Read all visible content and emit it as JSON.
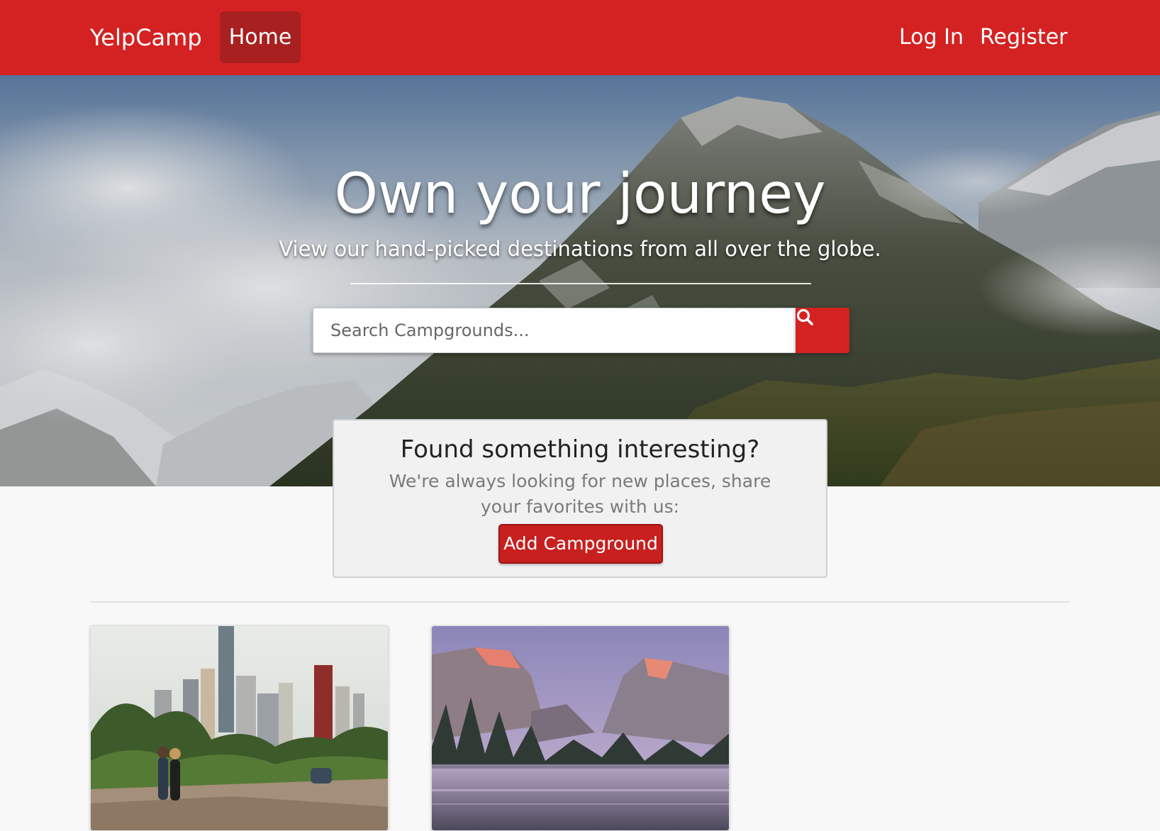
{
  "navbar": {
    "brand": "YelpCamp",
    "home_label": "Home",
    "login_label": "Log In",
    "register_label": "Register",
    "color": "#d42222",
    "active_color": "#a92020"
  },
  "hero": {
    "title": "Own your journey",
    "subtitle": "View our hand-picked destinations from all over the globe.",
    "search": {
      "placeholder": "Search Campgrounds...",
      "value": "",
      "button_icon": "search-icon"
    }
  },
  "callout": {
    "title": "Found something interesting?",
    "text": "We're always looking for new places, share your favorites with us:",
    "button_label": "Add Campground"
  },
  "campgrounds": [
    {
      "image": "city-park-photo"
    },
    {
      "image": "yosemite-valley-photo"
    }
  ]
}
